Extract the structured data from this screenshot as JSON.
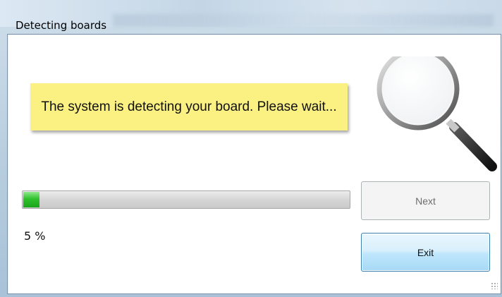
{
  "window": {
    "title": "Detecting boards"
  },
  "message": {
    "text": "The system is detecting your board. Please wait..."
  },
  "progress": {
    "percent_value": 5,
    "percent_label": "5 %"
  },
  "buttons": {
    "next_label": "Next",
    "next_enabled": false,
    "exit_label": "Exit"
  },
  "colors": {
    "message_background": "#fbf183",
    "progress_fill": "#2fc12d",
    "exit_border": "#3c7fb1"
  },
  "icons": {
    "magnifier": "magnifying-glass-icon"
  }
}
